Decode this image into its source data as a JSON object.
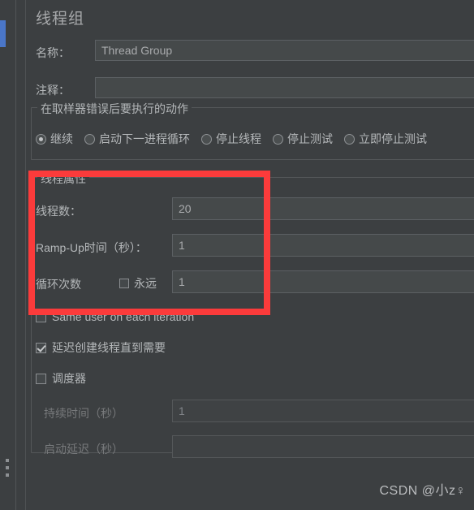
{
  "window": {
    "title": "线程组"
  },
  "fields": {
    "name_label": "名称：",
    "name_value": "Thread Group",
    "comment_label": "注释：",
    "comment_value": ""
  },
  "error_action_group": {
    "title": "在取样器错误后要执行的动作",
    "options": [
      {
        "label": "继续",
        "selected": true
      },
      {
        "label": "启动下一进程循环",
        "selected": false
      },
      {
        "label": "停止线程",
        "selected": false
      },
      {
        "label": "停止测试",
        "selected": false
      },
      {
        "label": "立即停止测试",
        "selected": false
      }
    ]
  },
  "thread_properties": {
    "title": "线程属性",
    "threads_label": "线程数：",
    "threads_value": "20",
    "rampup_label": "Ramp-Up时间（秒）：",
    "rampup_value": "1",
    "loops_label": "循环次数",
    "forever_label": "永远",
    "forever_checked": false,
    "loops_value": "1",
    "same_user_label": "Same user on each iteration",
    "same_user_checked": false,
    "delayed_start_label": "延迟创建线程直到需要",
    "delayed_start_checked": true,
    "scheduler_label": "调度器",
    "scheduler_checked": false,
    "duration_label": "持续时间（秒）",
    "duration_value": "1",
    "startup_delay_label": "启动延迟（秒）",
    "startup_delay_value": ""
  },
  "annotation": {
    "color": "#fb3b3b"
  },
  "watermark": {
    "text": "CSDN @小z♀"
  }
}
